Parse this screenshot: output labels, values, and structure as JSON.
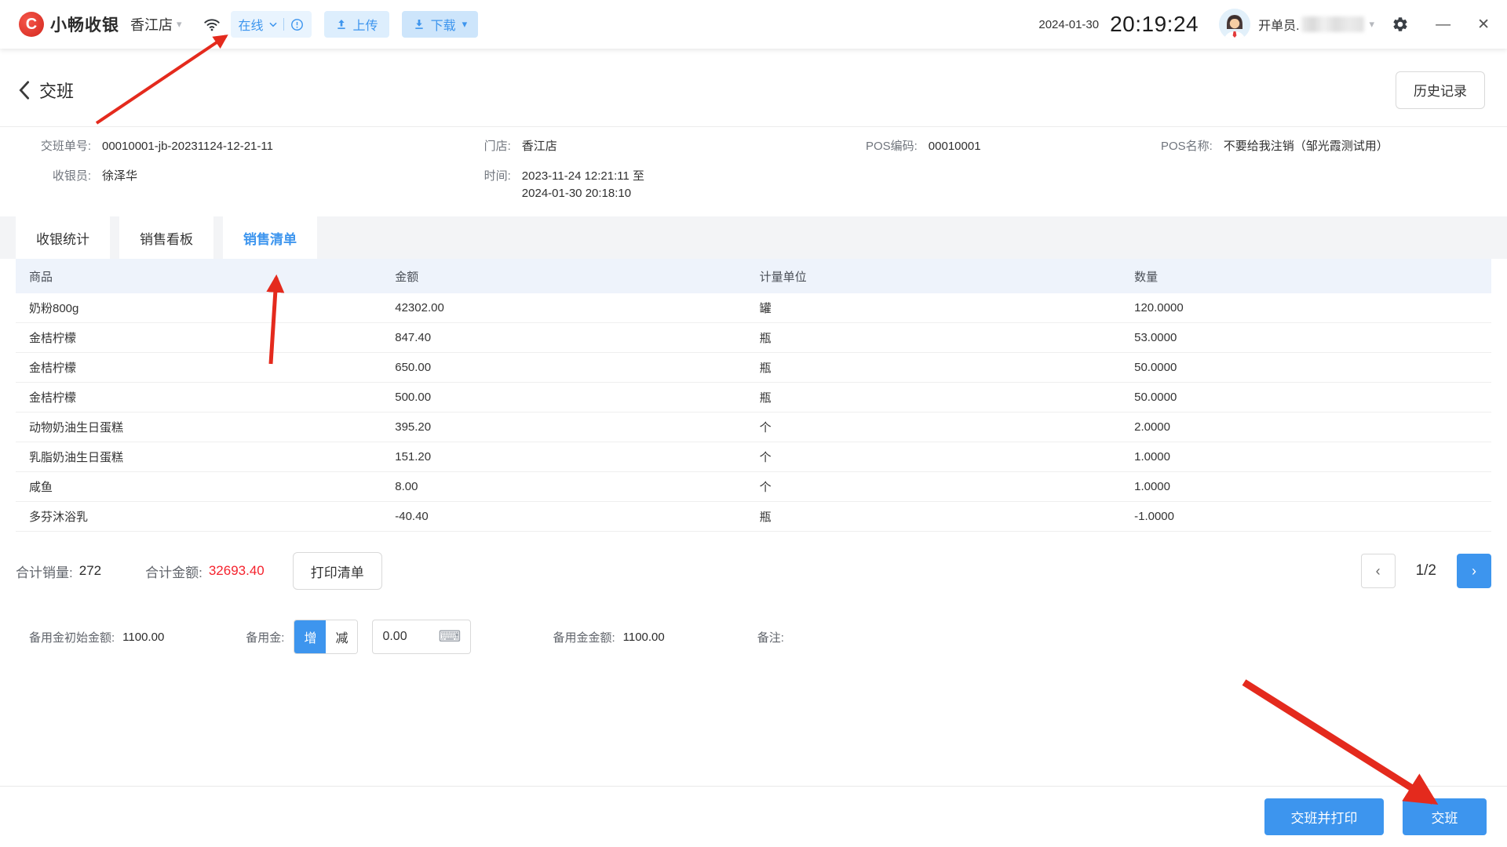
{
  "topbar": {
    "brand": "小畅收银",
    "store": "香江店",
    "status": "在线",
    "upload_label": "上传",
    "download_label": "下载",
    "date": "2024-01-30",
    "time": "20:19:24",
    "user_role": "开单员."
  },
  "header": {
    "title": "交班",
    "history_button": "历史记录"
  },
  "info": {
    "sheet_label": "交班单号:",
    "sheet_value": "00010001-jb-20231124-12-21-11",
    "store_label": "门店:",
    "store_value": "香江店",
    "pos_code_label": "POS编码:",
    "pos_code_value": "00010001",
    "pos_name_label": "POS名称:",
    "pos_name_value": "不要给我注销（邹光霞测试用）",
    "cashier_label": "收银员:",
    "cashier_value": "徐泽华",
    "time_label": "时间:",
    "time_value": "2023-11-24 12:21:11 至 2024-01-30 20:18:10"
  },
  "tabs": [
    {
      "label": "收银统计"
    },
    {
      "label": "销售看板"
    },
    {
      "label": "销售清单"
    }
  ],
  "table": {
    "columns": [
      "商品",
      "金额",
      "计量单位",
      "数量"
    ],
    "rows": [
      [
        "奶粉800g",
        "42302.00",
        "罐",
        "120.0000"
      ],
      [
        "金桔柠檬",
        "847.40",
        "瓶",
        "53.0000"
      ],
      [
        "金桔柠檬",
        "650.00",
        "瓶",
        "50.0000"
      ],
      [
        "金桔柠檬",
        "500.00",
        "瓶",
        "50.0000"
      ],
      [
        "动物奶油生日蛋糕",
        "395.20",
        "个",
        "2.0000"
      ],
      [
        "乳脂奶油生日蛋糕",
        "151.20",
        "个",
        "1.0000"
      ],
      [
        "咸鱼",
        "8.00",
        "个",
        "1.0000"
      ],
      [
        "多芬沐浴乳",
        "-40.40",
        "瓶",
        "-1.0000"
      ]
    ]
  },
  "summary": {
    "qty_label": "合计销量:",
    "qty_value": "272",
    "amount_label": "合计金额:",
    "amount_value": "32693.40",
    "print_button": "打印清单",
    "page_indicator": "1/2"
  },
  "reserve": {
    "initial_label": "备用金初始金额:",
    "initial_value": "1100.00",
    "adjust_label": "备用金:",
    "increase_label": "增",
    "decrease_label": "减",
    "input_value": "0.00",
    "amount_label": "备用金金额:",
    "amount_value": "1100.00",
    "remark_label": "备注:"
  },
  "footer": {
    "handover_print_button": "交班并打印",
    "handover_button": "交班"
  },
  "icons": {
    "chevron_down": "▾",
    "minimize": "—",
    "close": "✕",
    "prev": "‹",
    "next": "›",
    "keyboard": "⌨",
    "logo_letter": "C"
  },
  "colors": {
    "accent": "#3d95ee",
    "danger": "#f5222d",
    "annotation": "#e42a1d"
  }
}
